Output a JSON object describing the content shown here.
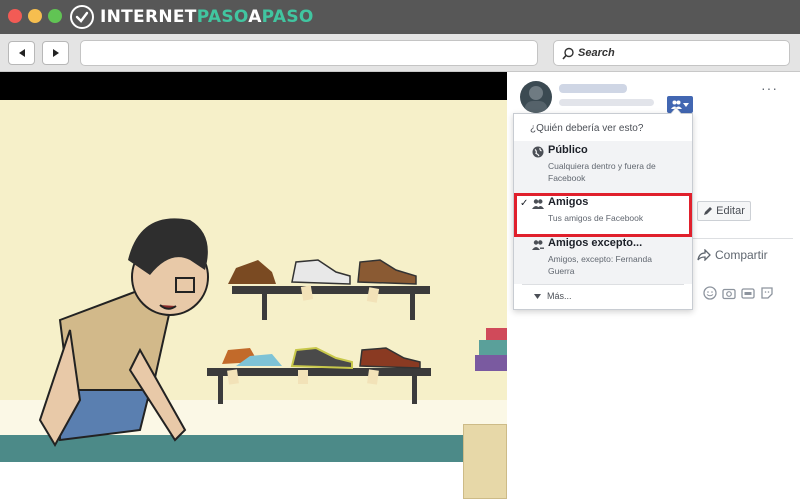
{
  "brand": {
    "logo_text_white": "INTERNET",
    "logo_text_green": "PASO",
    "logo_letter_a": "A",
    "logo_text_end": "PASO",
    "green_color": "#41c5a0"
  },
  "toolbar": {
    "back_icon": "arrow-left-icon",
    "forward_icon": "arrow-right-icon",
    "search_placeholder": "Search"
  },
  "post": {
    "more_options": "···",
    "edit_label": "Editar",
    "share_label": "Compartir"
  },
  "privacy_menu": {
    "header": "¿Quién debería ver esto?",
    "items": [
      {
        "title": "Público",
        "description": "Cualquiera dentro y fuera de Facebook",
        "icon": "globe-icon"
      },
      {
        "title": "Amigos",
        "description": "Tus amigos de Facebook",
        "icon": "friends-icon",
        "selected": true
      },
      {
        "title": "Amigos excepto...",
        "description": "Amigos, excepto: Fernanda Guerra",
        "icon": "friends-except-icon"
      }
    ],
    "more_label": "Más...",
    "highlight_color": "#e0202c"
  }
}
